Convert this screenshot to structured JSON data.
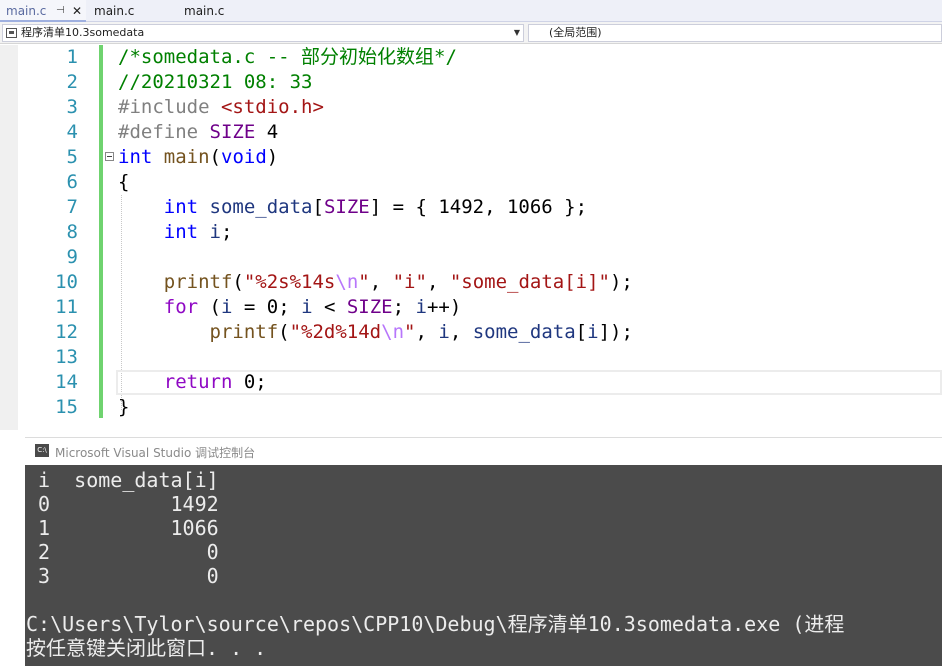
{
  "tabs": [
    {
      "label": "main.c",
      "active": true,
      "pin_icon": "pin-icon",
      "close_icon": "close-icon"
    },
    {
      "label": "main.c",
      "active": false
    },
    {
      "label": "main.c",
      "active": false
    }
  ],
  "navbar": {
    "project": "程序清单10.3somedata",
    "scope": "(全局范围)"
  },
  "editor": {
    "line_numbers": [
      "1",
      "2",
      "3",
      "4",
      "5",
      "6",
      "7",
      "8",
      "9",
      "10",
      "11",
      "12",
      "13",
      "14",
      "15"
    ],
    "lines": [
      [
        {
          "c": "comment",
          "t": "/*somedata.c -- 部分初始化数组*/"
        }
      ],
      [
        {
          "c": "comment",
          "t": "//20210321 08: 33"
        }
      ],
      [
        {
          "c": "pre",
          "t": "#include "
        },
        {
          "c": "inc",
          "t": "<stdio.h>"
        }
      ],
      [
        {
          "c": "pre",
          "t": "#define "
        },
        {
          "c": "macro",
          "t": "SIZE"
        },
        {
          "c": "plain",
          "t": " 4"
        }
      ],
      [
        {
          "c": "kw",
          "t": "int"
        },
        {
          "c": "plain",
          "t": " "
        },
        {
          "c": "fn",
          "t": "main"
        },
        {
          "c": "plain",
          "t": "("
        },
        {
          "c": "kw",
          "t": "void"
        },
        {
          "c": "plain",
          "t": ")"
        }
      ],
      [
        {
          "c": "plain",
          "t": "{"
        }
      ],
      [
        {
          "c": "plain",
          "t": "    "
        },
        {
          "c": "kw",
          "t": "int"
        },
        {
          "c": "plain",
          "t": " "
        },
        {
          "c": "var",
          "t": "some_data"
        },
        {
          "c": "plain",
          "t": "["
        },
        {
          "c": "macro",
          "t": "SIZE"
        },
        {
          "c": "plain",
          "t": "] = { 1492, 1066 };"
        }
      ],
      [
        {
          "c": "plain",
          "t": "    "
        },
        {
          "c": "kw",
          "t": "int"
        },
        {
          "c": "plain",
          "t": " "
        },
        {
          "c": "var",
          "t": "i"
        },
        {
          "c": "plain",
          "t": ";"
        }
      ],
      [
        {
          "c": "plain",
          "t": ""
        }
      ],
      [
        {
          "c": "plain",
          "t": "    "
        },
        {
          "c": "fn",
          "t": "printf"
        },
        {
          "c": "plain",
          "t": "("
        },
        {
          "c": "str",
          "t": "\"%2s%14s"
        },
        {
          "c": "esc",
          "t": "\\n"
        },
        {
          "c": "str",
          "t": "\""
        },
        {
          "c": "plain",
          "t": ", "
        },
        {
          "c": "str",
          "t": "\"i\""
        },
        {
          "c": "plain",
          "t": ", "
        },
        {
          "c": "str",
          "t": "\"some_data[i]\""
        },
        {
          "c": "plain",
          "t": ");"
        }
      ],
      [
        {
          "c": "plain",
          "t": "    "
        },
        {
          "c": "ctl",
          "t": "for"
        },
        {
          "c": "plain",
          "t": " ("
        },
        {
          "c": "var",
          "t": "i"
        },
        {
          "c": "plain",
          "t": " = 0; "
        },
        {
          "c": "var",
          "t": "i"
        },
        {
          "c": "plain",
          "t": " < "
        },
        {
          "c": "macro",
          "t": "SIZE"
        },
        {
          "c": "plain",
          "t": "; "
        },
        {
          "c": "var",
          "t": "i"
        },
        {
          "c": "plain",
          "t": "++)"
        }
      ],
      [
        {
          "c": "plain",
          "t": "        "
        },
        {
          "c": "fn",
          "t": "printf"
        },
        {
          "c": "plain",
          "t": "("
        },
        {
          "c": "str",
          "t": "\"%2d%14d"
        },
        {
          "c": "esc",
          "t": "\\n"
        },
        {
          "c": "str",
          "t": "\""
        },
        {
          "c": "plain",
          "t": ", "
        },
        {
          "c": "var",
          "t": "i"
        },
        {
          "c": "plain",
          "t": ", "
        },
        {
          "c": "var",
          "t": "some_data"
        },
        {
          "c": "plain",
          "t": "["
        },
        {
          "c": "var",
          "t": "i"
        },
        {
          "c": "plain",
          "t": "]);"
        }
      ],
      [
        {
          "c": "plain",
          "t": ""
        }
      ],
      [
        {
          "c": "plain",
          "t": "    "
        },
        {
          "c": "ctl",
          "t": "return"
        },
        {
          "c": "plain",
          "t": " 0;"
        }
      ],
      [
        {
          "c": "plain",
          "t": "}"
        }
      ]
    ]
  },
  "console": {
    "title": "Microsoft Visual Studio 调试控制台",
    "icon": "console-app-icon",
    "lines": [
      " i  some_data[i]",
      " 0          1492",
      " 1          1066",
      " 2             0",
      " 3             0",
      "",
      "C:\\Users\\Tylor\\source\\repos\\CPP10\\Debug\\程序清单10.3somedata.exe (进程",
      "按任意键关闭此窗口. . ."
    ]
  },
  "colors": {
    "comment": "#008000",
    "keyword": "#0000ff",
    "control": "#8f08c4",
    "macro": "#6f008a",
    "string": "#a31515",
    "line_number": "#2b91af",
    "change_bar": "#6fd36f",
    "console_bg": "#4b4b4b"
  }
}
